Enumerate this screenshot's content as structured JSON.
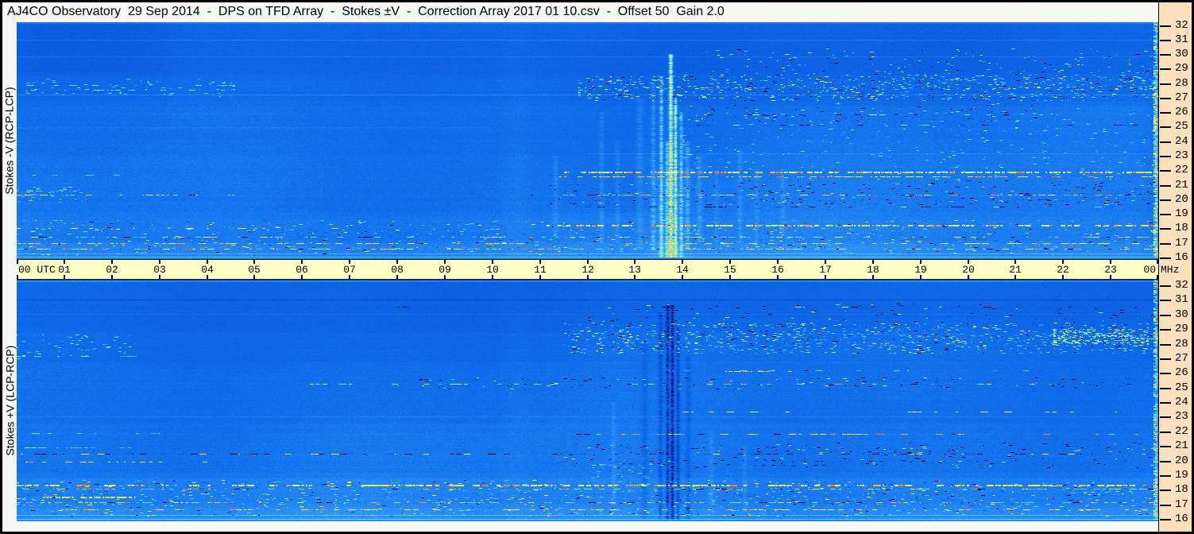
{
  "title": "AJ4CO Observatory  29 Sep 2014  -  DPS on TFD Array  -  Stokes ±V  -  Correction Array 2017 01 10.csv  -  Offset 50  Gain 2.0",
  "colors": {
    "background_blue": "#106ee8",
    "time_band": "#ffffc6",
    "freq_strip": "#fcdfbd",
    "title_bg": "#f6f6f4",
    "border": "#000000"
  },
  "time_axis": {
    "left_label": "00 UTC",
    "hours": [
      "01",
      "02",
      "03",
      "04",
      "05",
      "06",
      "07",
      "08",
      "09",
      "10",
      "11",
      "12",
      "13",
      "14",
      "15",
      "16",
      "17",
      "18",
      "19",
      "20",
      "21",
      "22",
      "23"
    ],
    "right_label": "00",
    "unit_label": "MHz"
  },
  "freq_axis": {
    "unit": "MHz",
    "labels": [
      "32",
      "31",
      "30",
      "29",
      "28",
      "27",
      "26",
      "25",
      "24",
      "23",
      "22",
      "21",
      "20",
      "19",
      "18",
      "17",
      "16"
    ]
  },
  "chart_data": {
    "type": "heatmap",
    "title": "Dual-polarization dynamic spectrum (DPS), 24-hour radio spectrogram",
    "x_axis": {
      "label": "UTC",
      "range_hours": [
        0,
        24
      ],
      "tick_interval_hours": 1
    },
    "y_axis": {
      "label": "MHz",
      "range_mhz": [
        16,
        32
      ],
      "tick_interval_mhz": 1
    },
    "colormap": "black-blue-cyan-green-yellow-orange-red jet-like intensity scale",
    "panels": [
      {
        "label": "Stokes -V (RCP-LCP)",
        "base_bands": [
          {
            "f0": 28.6,
            "f1": 32.3,
            "v": 0.36
          },
          {
            "f0": 26.6,
            "f1": 28.6,
            "v": 0.383
          },
          {
            "f0": 23.0,
            "f1": 26.6,
            "v": 0.4
          },
          {
            "f0": 19.0,
            "f1": 23.0,
            "v": 0.413
          },
          {
            "f0": 17.0,
            "f1": 19.0,
            "v": 0.432
          },
          {
            "f0": 15.5,
            "f1": 17.0,
            "v": 0.465
          }
        ],
        "washes": [
          {
            "t0": 13.0,
            "t1": 24,
            "f0": 19.0,
            "f1": 26.5,
            "dv": 0.012
          },
          {
            "t0": 11.0,
            "t1": 24,
            "f0": 16.0,
            "f1": 19.0,
            "dv": 0.01
          },
          {
            "t0": 0,
            "t1": 3.5,
            "f0": 28.5,
            "f1": 32.3,
            "dv": -0.012
          },
          {
            "t0": 10.1,
            "t1": 10.9,
            "f0": 16,
            "f1": 32.2,
            "dv": 0.022
          }
        ],
        "hlines": [
          {
            "f": 32.12,
            "t0": 0,
            "t1": 24,
            "style": "faint",
            "dv": 0.12
          },
          {
            "f": 31.0,
            "t0": 0,
            "t1": 24,
            "style": "faint",
            "dv": 0.07
          },
          {
            "f": 29.85,
            "t0": 0,
            "t1": 24,
            "style": "faint",
            "dv": 0.05
          },
          {
            "f": 27.2,
            "t0": 0,
            "t1": 24,
            "style": "faint",
            "dv": 0.08
          },
          {
            "f": 27.9,
            "t0": 0.2,
            "t1": 4.6,
            "style": "speckle",
            "mix": "cool",
            "density": 0.3
          },
          {
            "f": 27.55,
            "t0": 0.3,
            "t1": 4.2,
            "style": "speckle",
            "mix": "cool",
            "density": 0.25
          },
          {
            "f": 25.0,
            "t0": 0,
            "t1": 10,
            "style": "faint",
            "dv": 0.035
          },
          {
            "f": 25.85,
            "t0": 13.8,
            "t1": 21.5,
            "style": "speckle",
            "mix": "darkband",
            "density": 0.22
          },
          {
            "f": 25.15,
            "t0": 13.0,
            "t1": 24,
            "style": "speckle",
            "mix": "darkband",
            "density": 0.18
          },
          {
            "f": 23.2,
            "t0": 12,
            "t1": 24,
            "style": "faint",
            "dv": 0.05
          },
          {
            "f": 21.92,
            "t0": 11.4,
            "t1": 24,
            "style": "yellow",
            "density": 0.8,
            "th": 2
          },
          {
            "f": 21.6,
            "t0": 11.4,
            "t1": 24,
            "style": "yellow",
            "density": 0.55
          },
          {
            "f": 21.7,
            "t0": 0,
            "t1": 2.2,
            "style": "speckle",
            "mix": "cool",
            "density": 0.25
          },
          {
            "f": 20.32,
            "t0": 0,
            "t1": 4.6,
            "style": "multicolor",
            "density": 0.4
          },
          {
            "f": 20.32,
            "t0": 10.8,
            "t1": 24,
            "style": "multicolor",
            "density": 0.55
          },
          {
            "f": 19.5,
            "t0": 11.5,
            "t1": 24,
            "style": "speckle",
            "mix": "darkband",
            "density": 0.25
          },
          {
            "f": 18.25,
            "t0": 11,
            "t1": 24,
            "style": "yellow",
            "density": 0.75,
            "th": 2
          },
          {
            "f": 18.05,
            "t0": 0,
            "t1": 7,
            "style": "yellow",
            "density": 0.4
          },
          {
            "f": 17.45,
            "t0": 0,
            "t1": 24,
            "style": "multicolor",
            "density": 0.45
          },
          {
            "f": 17.0,
            "t0": 0,
            "t1": 24,
            "style": "yellow",
            "density": 0.4
          },
          {
            "f": 16.62,
            "t0": 0,
            "t1": 24,
            "style": "multicolor",
            "density": 0.55
          },
          {
            "f": 16.3,
            "t0": 0,
            "t1": 24,
            "style": "faint",
            "dv": 0.09
          },
          {
            "f": 16.05,
            "t0": 0,
            "t1": 24,
            "style": "faint",
            "dv": 0.12
          }
        ],
        "speckle_bands": [
          {
            "f0": 26.8,
            "f1": 28.6,
            "t0": 11.8,
            "t1": 24,
            "density": 0.3,
            "mix": "band"
          },
          {
            "f0": 28.6,
            "f1": 30.4,
            "t0": 14.5,
            "t1": 24,
            "density": 0.08,
            "mix": "band"
          },
          {
            "f0": 25.3,
            "f1": 26.6,
            "t0": 13.8,
            "t1": 21.5,
            "density": 0.07,
            "mix": "darkband"
          },
          {
            "f0": 19.6,
            "f1": 21.3,
            "t0": 11.2,
            "t1": 24,
            "density": 0.09,
            "mix": "darkband"
          },
          {
            "f0": 16.2,
            "f1": 18.6,
            "t0": 0,
            "t1": 24,
            "density": 0.1,
            "mix": "band"
          },
          {
            "f0": 27.0,
            "f1": 28.3,
            "t0": 0.2,
            "t1": 4.6,
            "density": 0.1,
            "mix": "cool"
          },
          {
            "f0": 19.8,
            "f1": 20.9,
            "t0": 0,
            "t1": 1.5,
            "density": 0.16,
            "mix": "cool"
          },
          {
            "f0": 21.3,
            "f1": 26.3,
            "t0": 14,
            "t1": 24,
            "density": 0.04,
            "mix": "cool"
          },
          {
            "f0": 16.0,
            "f1": 32.2,
            "t0": 23.9,
            "t1": 24,
            "density": 0.5,
            "mix": "bright"
          }
        ],
        "vlines": [
          {
            "t": 11.33,
            "f0": 17.5,
            "f1": 23,
            "dv": 0.05,
            "w": 2
          },
          {
            "t": 12.3,
            "f0": 17,
            "f1": 26,
            "dv": 0.06,
            "w": 2
          },
          {
            "t": 12.62,
            "f0": 17,
            "f1": 24,
            "dv": 0.05,
            "w": 2
          },
          {
            "t": 13.1,
            "f0": 16.5,
            "f1": 27,
            "dv": 0.06,
            "w": 3
          },
          {
            "t": 13.38,
            "f0": 16.5,
            "f1": 28,
            "dv": 0.1,
            "w": 2
          },
          {
            "t": 13.55,
            "f0": 16,
            "f1": 28.5,
            "dv": 0.22,
            "w": 1.6
          },
          {
            "t": 13.66,
            "f0": 16,
            "f1": 24,
            "dv": 0.17,
            "w": 1.4
          },
          {
            "t": 13.74,
            "f0": 16,
            "f1": 30,
            "dv": 0.42,
            "w": 1.8,
            "core": true
          },
          {
            "t": 13.85,
            "f0": 16,
            "f1": 27,
            "dv": 0.3,
            "w": 1.5,
            "core": true
          },
          {
            "t": 13.97,
            "f0": 16,
            "f1": 26,
            "dv": 0.17,
            "w": 1.6
          },
          {
            "t": 14.1,
            "f0": 16.5,
            "f1": 24,
            "dv": 0.11,
            "w": 2
          },
          {
            "t": 14.35,
            "f0": 17,
            "f1": 23,
            "dv": 0.07,
            "w": 2.5
          },
          {
            "t": 14.7,
            "f0": 17,
            "f1": 22,
            "dv": 0.05,
            "w": 2
          },
          {
            "t": 15.2,
            "f0": 17,
            "f1": 23.5,
            "dv": 0.06,
            "w": 2
          },
          {
            "t": 15.55,
            "f0": 17,
            "f1": 22,
            "dv": 0.05,
            "w": 2
          },
          {
            "t": 16.1,
            "f0": 17.5,
            "f1": 22,
            "dv": 0.05,
            "w": 2.5
          },
          {
            "t": 13.7,
            "f0": 16,
            "f1": 22,
            "dv": 0.04,
            "w": 16
          },
          {
            "t": 23.95,
            "f0": 16,
            "f1": 32.2,
            "dv": 0.25,
            "w": 1.2
          }
        ]
      },
      {
        "label": "Stokes +V (LCP-RCP)",
        "base_bands": [
          {
            "f0": 28.8,
            "f1": 32.3,
            "v": 0.365
          },
          {
            "f0": 26.5,
            "f1": 28.8,
            "v": 0.385
          },
          {
            "f0": 22.5,
            "f1": 26.5,
            "v": 0.403
          },
          {
            "f0": 19.0,
            "f1": 22.5,
            "v": 0.418
          },
          {
            "f0": 17.0,
            "f1": 19.0,
            "v": 0.438
          },
          {
            "f0": 15.5,
            "f1": 17.0,
            "v": 0.47
          }
        ],
        "washes": [
          {
            "t0": 11.5,
            "t1": 24,
            "f0": 26.5,
            "f1": 29.5,
            "dv": 0.012
          },
          {
            "t0": 0,
            "t1": 24,
            "f0": 16.0,
            "f1": 18.8,
            "dv": 0.008
          },
          {
            "t0": 10.1,
            "t1": 10.9,
            "f0": 16,
            "f1": 32.2,
            "dv": 0.018
          }
        ],
        "hlines": [
          {
            "f": 32.1,
            "t0": 0,
            "t1": 24,
            "style": "faint",
            "dv": 0.12
          },
          {
            "f": 30.85,
            "t0": 0,
            "t1": 24,
            "style": "dark",
            "dv": -0.1
          },
          {
            "f": 30.4,
            "t0": 8,
            "t1": 24,
            "style": "speckle",
            "mix": "darkband",
            "density": 0.15
          },
          {
            "f": 29.9,
            "t0": 0,
            "t1": 24,
            "style": "faint",
            "dv": 0.05
          },
          {
            "f": 27.05,
            "t0": 0,
            "t1": 3,
            "style": "speckle",
            "mix": "cool",
            "density": 0.22
          },
          {
            "f": 26.05,
            "t0": 14.9,
            "t1": 16.3,
            "style": "yellow",
            "density": 0.65
          },
          {
            "f": 26.1,
            "t0": 12,
            "t1": 24,
            "style": "speckle",
            "mix": "band",
            "density": 0.16
          },
          {
            "f": 25.2,
            "t0": 6,
            "t1": 24,
            "style": "multicolor",
            "density": 0.3
          },
          {
            "f": 23.3,
            "t0": 13.5,
            "t1": 24,
            "style": "speckle",
            "mix": "warm",
            "density": 0.3
          },
          {
            "f": 23.0,
            "t0": 0,
            "t1": 24,
            "style": "faint",
            "dv": 0.045
          },
          {
            "f": 21.8,
            "t0": 11.5,
            "t1": 24,
            "style": "multicolor",
            "density": 0.4
          },
          {
            "f": 21.85,
            "t0": 0,
            "t1": 3,
            "style": "speckle",
            "mix": "cool",
            "density": 0.28
          },
          {
            "f": 20.9,
            "t0": 0,
            "t1": 2.5,
            "style": "speckle",
            "mix": "cool",
            "density": 0.35
          },
          {
            "f": 20.45,
            "t0": 0,
            "t1": 24,
            "style": "darkline",
            "density": 0.5
          },
          {
            "f": 19.9,
            "t0": 0,
            "t1": 4,
            "style": "yellow",
            "density": 0.35
          },
          {
            "f": 18.35,
            "t0": 0,
            "t1": 24,
            "style": "yellow",
            "density": 0.7,
            "th": 2
          },
          {
            "f": 18.1,
            "t0": 0,
            "t1": 24,
            "style": "multicolor",
            "density": 0.4
          },
          {
            "f": 17.55,
            "t0": 0.55,
            "t1": 2.5,
            "style": "brightyellow",
            "density": 0.95,
            "th": 2
          },
          {
            "f": 17.2,
            "t0": 0,
            "t1": 24,
            "style": "multicolor",
            "density": 0.5
          },
          {
            "f": 16.7,
            "t0": 0,
            "t1": 24,
            "style": "yellow",
            "density": 0.4
          },
          {
            "f": 16.35,
            "t0": 0,
            "t1": 24,
            "style": "faint",
            "dv": 0.1
          },
          {
            "f": 16.05,
            "t0": 0,
            "t1": 24,
            "style": "faint",
            "dv": 0.13
          }
        ],
        "speckle_bands": [
          {
            "f0": 27.2,
            "f1": 29.3,
            "t0": 11.5,
            "t1": 24,
            "density": 0.28,
            "mix": "band"
          },
          {
            "f0": 27.8,
            "f1": 28.9,
            "t0": 21.8,
            "t1": 23.8,
            "density": 0.5,
            "mix": "bright"
          },
          {
            "f0": 29.3,
            "f1": 30.6,
            "t0": 12,
            "t1": 24,
            "density": 0.06,
            "mix": "darkband"
          },
          {
            "f0": 24.8,
            "f1": 25.6,
            "t0": 8,
            "t1": 24,
            "density": 0.08,
            "mix": "darkband"
          },
          {
            "f0": 16.2,
            "f1": 18.7,
            "t0": 0,
            "t1": 24,
            "density": 0.12,
            "mix": "band"
          },
          {
            "f0": 19.5,
            "f1": 21.2,
            "t0": 11.5,
            "t1": 24,
            "density": 0.08,
            "mix": "darkband"
          },
          {
            "f0": 18.8,
            "f1": 19.8,
            "t0": 12.1,
            "t1": 13.6,
            "density": 0.25,
            "mix": "cool"
          },
          {
            "f0": 26.8,
            "f1": 28.5,
            "t0": 0,
            "t1": 2.5,
            "density": 0.1,
            "mix": "cool"
          },
          {
            "f0": 16.0,
            "f1": 32.2,
            "t0": 23.9,
            "t1": 24,
            "density": 0.45,
            "mix": "bright"
          }
        ],
        "vlines": [
          {
            "t": 12.55,
            "f0": 17,
            "f1": 24,
            "dv": 0.05,
            "w": 2
          },
          {
            "t": 13.2,
            "f0": 16,
            "f1": 28,
            "dv": -0.06,
            "w": 2.5
          },
          {
            "t": 13.52,
            "f0": 16,
            "f1": 30,
            "dv": -0.12,
            "w": 1.8
          },
          {
            "t": 13.68,
            "f0": 16,
            "f1": 30.5,
            "dv": -0.22,
            "w": 1.6,
            "core": true
          },
          {
            "t": 13.78,
            "f0": 16,
            "f1": 30.5,
            "dv": -0.3,
            "w": 1.4,
            "core": true
          },
          {
            "t": 13.9,
            "f0": 16,
            "f1": 29,
            "dv": -0.18,
            "w": 1.6
          },
          {
            "t": 14.12,
            "f0": 16,
            "f1": 27,
            "dv": -0.08,
            "w": 2
          },
          {
            "t": 14.6,
            "f0": 16.5,
            "f1": 22,
            "dv": 0.05,
            "w": 2.5
          },
          {
            "t": 15.3,
            "f0": 16.5,
            "f1": 21,
            "dv": 0.05,
            "w": 2
          },
          {
            "t": 23.95,
            "f0": 16,
            "f1": 32.2,
            "dv": 0.23,
            "w": 1.2
          }
        ]
      }
    ]
  }
}
